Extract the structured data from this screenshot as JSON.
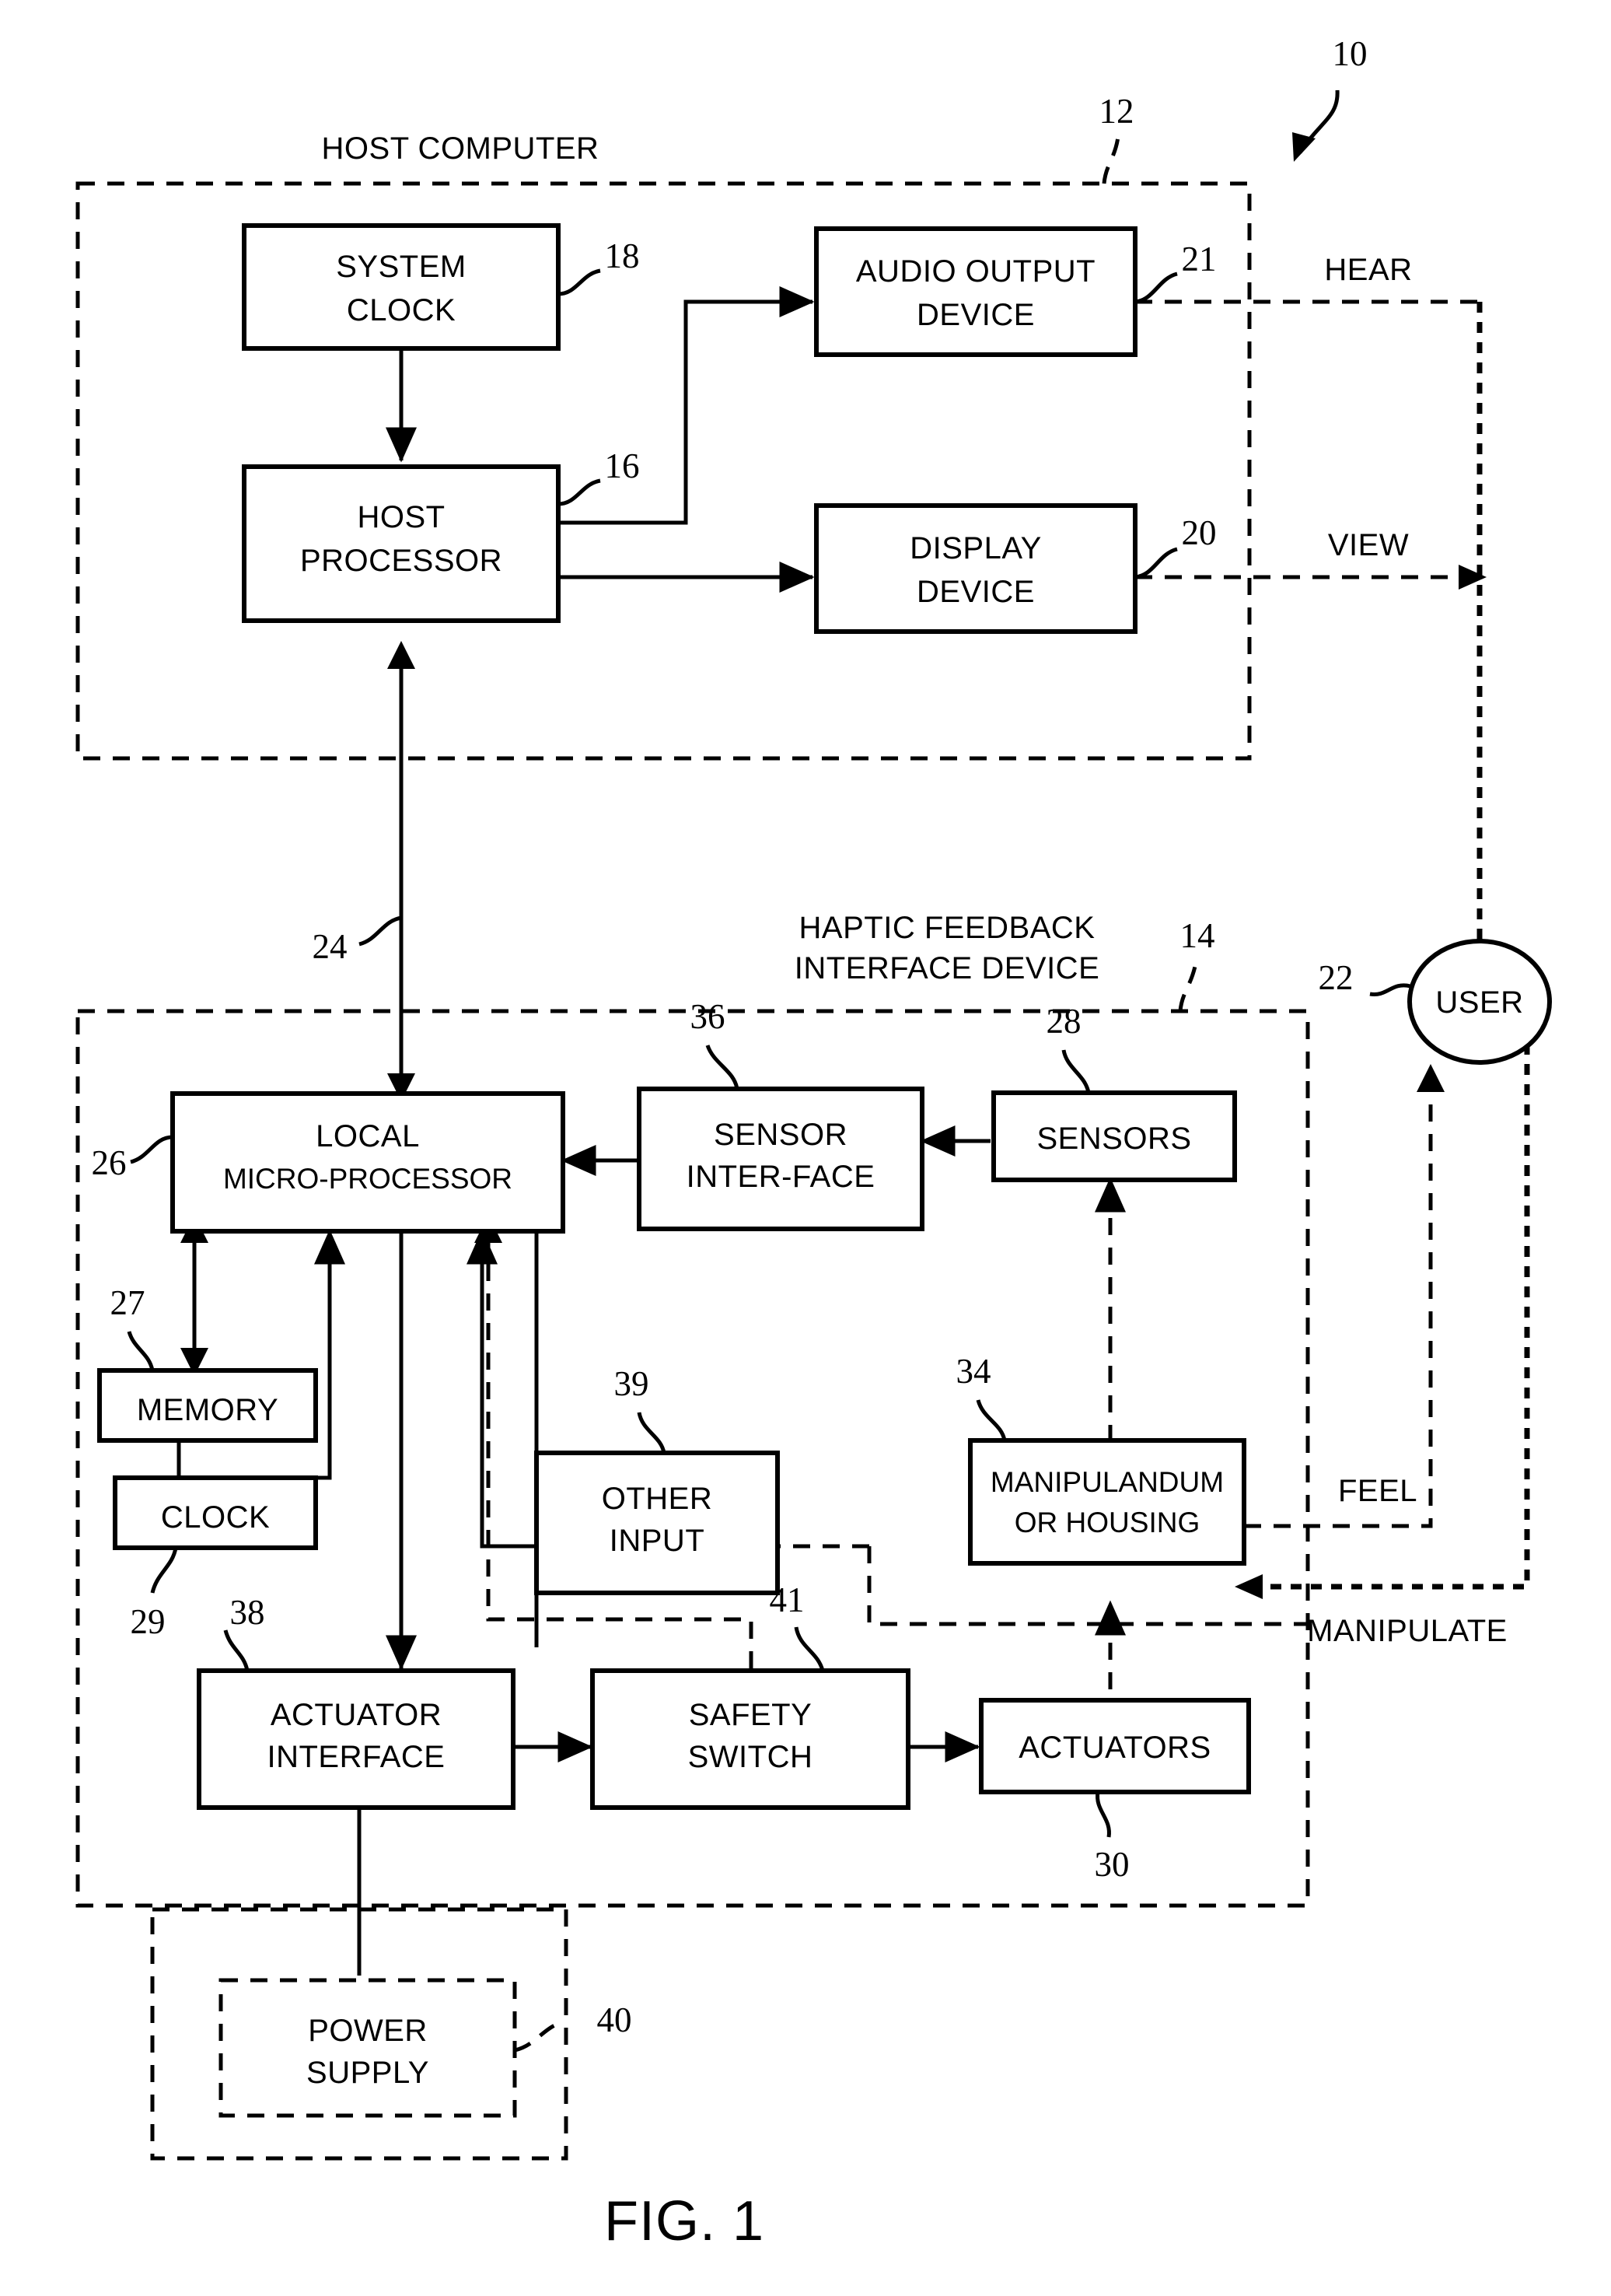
{
  "figure": {
    "caption": "FIG. 1",
    "system_ref": "10"
  },
  "groups": [
    {
      "id": "host-computer",
      "label": "HOST COMPUTER",
      "ref": "12"
    },
    {
      "id": "haptic-device",
      "label_line1": "HAPTIC FEEDBACK",
      "label_line2": "INTERFACE DEVICE",
      "ref": "14"
    },
    {
      "id": "power-supply-group",
      "ref": "40"
    }
  ],
  "blocks": [
    {
      "id": "system-clock",
      "line1": "SYSTEM",
      "line2": "CLOCK",
      "ref": "18"
    },
    {
      "id": "host-processor",
      "line1": "HOST",
      "line2": "PROCESSOR",
      "ref": "16"
    },
    {
      "id": "audio-output",
      "line1": "AUDIO OUTPUT",
      "line2": "DEVICE",
      "ref": "21"
    },
    {
      "id": "display-device",
      "line1": "DISPLAY",
      "line2": "DEVICE",
      "ref": "20"
    },
    {
      "id": "local-micro",
      "line1": "LOCAL",
      "line2": "MICRO-PROCESSOR",
      "ref": "26"
    },
    {
      "id": "sensor-interface",
      "line1": "SENSOR",
      "line2": "INTER-FACE",
      "ref": "36"
    },
    {
      "id": "sensors",
      "line1": "SENSORS",
      "line2": "",
      "ref": "28"
    },
    {
      "id": "memory",
      "line1": "MEMORY",
      "line2": "",
      "ref": "27"
    },
    {
      "id": "clock",
      "line1": "CLOCK",
      "line2": "",
      "ref": "29"
    },
    {
      "id": "other-input",
      "line1": "OTHER",
      "line2": "INPUT",
      "ref": "39"
    },
    {
      "id": "manipulandum",
      "line1": "MANIPULANDUM",
      "line2": "OR HOUSING",
      "ref": "34"
    },
    {
      "id": "actuator-interface",
      "line1": "ACTUATOR",
      "line2": "INTERFACE",
      "ref": "38"
    },
    {
      "id": "safety-switch",
      "line1": "SAFETY",
      "line2": "SWITCH",
      "ref": "41"
    },
    {
      "id": "actuators",
      "line1": "ACTUATORS",
      "line2": "",
      "ref": "30"
    },
    {
      "id": "power-supply",
      "line1": "POWER",
      "line2": "SUPPLY",
      "ref": "40"
    },
    {
      "id": "user",
      "line1": "USER",
      "line2": "",
      "ref": "22"
    }
  ],
  "flow_labels": [
    {
      "id": "hear",
      "text": "HEAR"
    },
    {
      "id": "view",
      "text": "VIEW"
    },
    {
      "id": "feel",
      "text": "FEEL"
    },
    {
      "id": "manipulate",
      "text": "MANIPULATE"
    }
  ],
  "connection_refs": [
    {
      "id": "bus-24",
      "ref": "24"
    }
  ],
  "colors": {
    "ink": "#000000",
    "paper": "#ffffff"
  }
}
